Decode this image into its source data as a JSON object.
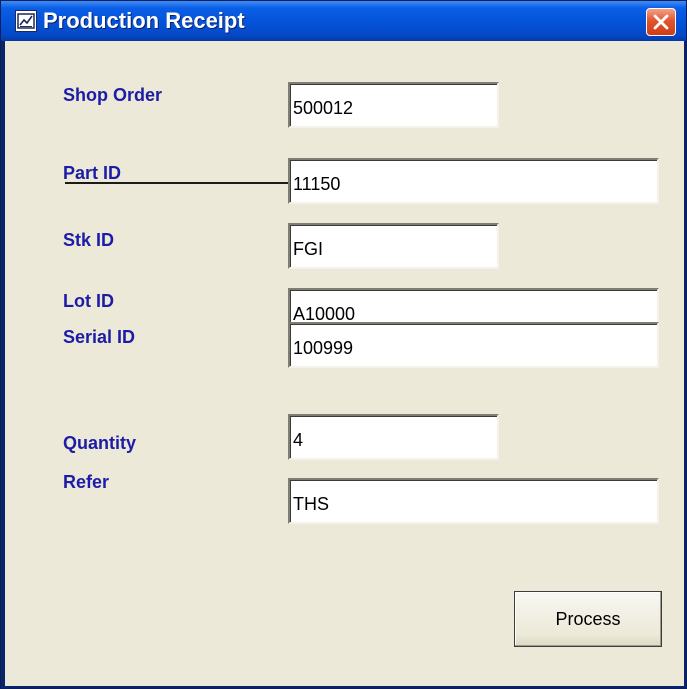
{
  "window": {
    "title": "Production Receipt",
    "close_label": "✕"
  },
  "form": {
    "shop_order": {
      "label": "Shop Order",
      "value": "500012"
    },
    "part_id": {
      "label": "Part ID",
      "value": "11150"
    },
    "stk_id": {
      "label": "Stk ID",
      "value": "FGI"
    },
    "lot_id": {
      "label": "Lot ID",
      "value": "A10000"
    },
    "serial_id": {
      "label": "Serial ID",
      "value": "100999"
    },
    "quantity": {
      "label": "Quantity",
      "value": "4"
    },
    "refer": {
      "label": "Refer",
      "value": "THS"
    }
  },
  "buttons": {
    "process_label": "Process"
  },
  "colors": {
    "label_blue": "#1c1ca6",
    "dialog_bg": "#ece9d8",
    "titlebar_blue": "#0453d9",
    "close_red": "#e2542e"
  },
  "icons": {
    "app": "chart-window-icon",
    "close": "close-icon"
  }
}
